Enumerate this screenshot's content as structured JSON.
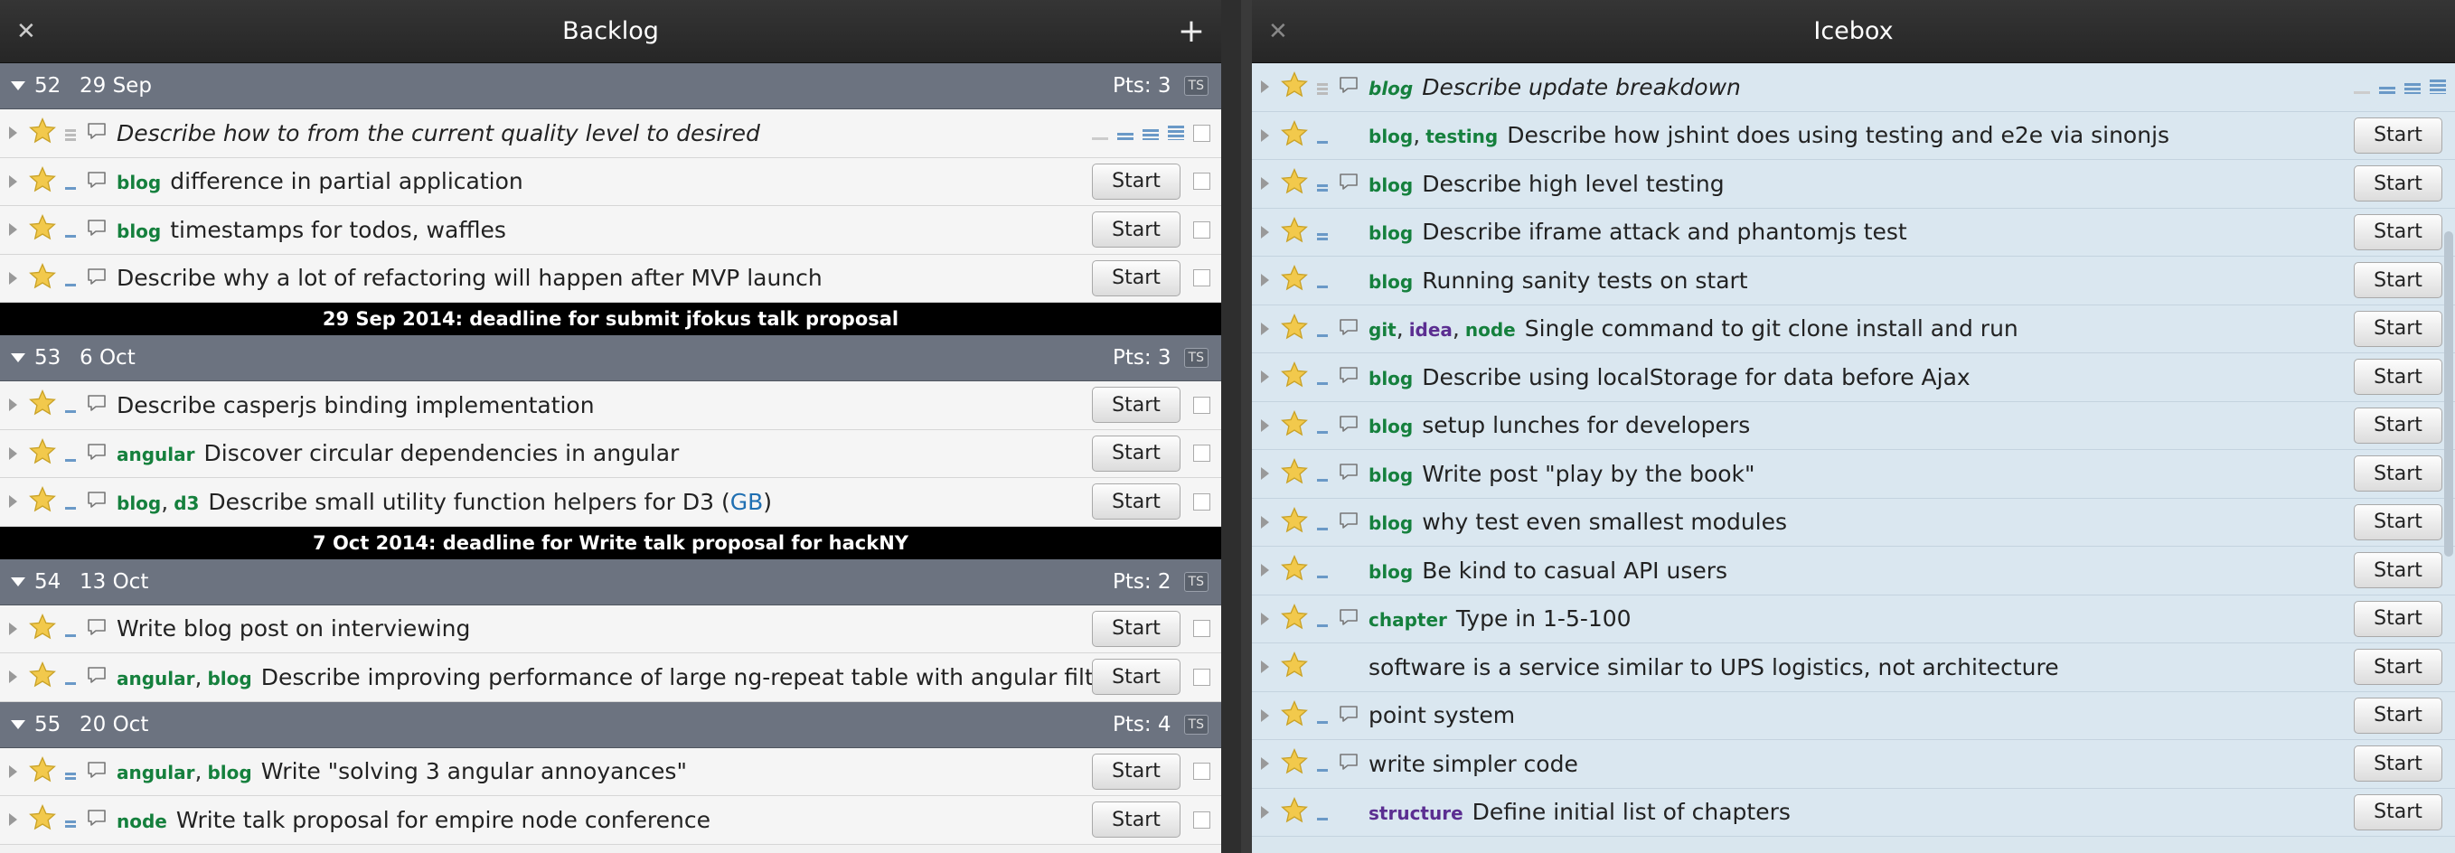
{
  "backlog": {
    "title": "Backlog",
    "close": "✕",
    "add": "+",
    "iterations": [
      {
        "num": "52",
        "date": "29 Sep",
        "pts": "Pts: 3",
        "ts": "TS",
        "stories": [
          {
            "labels": [],
            "title": "Describe how to from the current quality level to desired",
            "italic": true,
            "estimate": "0",
            "comments": true,
            "start": "",
            "edit": true
          },
          {
            "labels": [
              "blog"
            ],
            "title": "difference in partial application",
            "estimate": "1",
            "comments": true,
            "start": "Start"
          },
          {
            "labels": [
              "blog"
            ],
            "title": "timestamps for todos, waffles",
            "estimate": "1",
            "comments": true,
            "start": "Start"
          },
          {
            "labels": [],
            "title": "Describe why a lot of refactoring will happen after MVP launch",
            "estimate": "1",
            "comments": true,
            "start": "Start"
          }
        ],
        "deadline": "29 Sep 2014: deadline for submit jfokus talk proposal"
      },
      {
        "num": "53",
        "date": "6 Oct",
        "pts": "Pts: 3",
        "ts": "TS",
        "stories": [
          {
            "labels": [],
            "title": "Describe casperjs binding implementation",
            "estimate": "1",
            "comments": true,
            "start": "Start"
          },
          {
            "labels": [
              "angular"
            ],
            "title": "Discover circular dependencies in angular",
            "estimate": "1",
            "comments": true,
            "start": "Start"
          },
          {
            "labels": [
              "blog",
              "d3"
            ],
            "title": "Describe small utility function helpers for D3 (",
            "link": "GB",
            "after": ")",
            "estimate": "1",
            "comments": true,
            "start": "Start"
          }
        ],
        "deadline": "7 Oct 2014: deadline for Write talk proposal for hackNY"
      },
      {
        "num": "54",
        "date": "13 Oct",
        "pts": "Pts: 2",
        "ts": "TS",
        "stories": [
          {
            "labels": [],
            "title": "Write blog post on interviewing",
            "estimate": "1",
            "comments": true,
            "start": "Start"
          },
          {
            "labels": [
              "angular",
              "blog"
            ],
            "title": "Describe improving performance of large ng-repeat table with angular filters",
            "estimate": "1",
            "comments": true,
            "start": "Start"
          }
        ]
      },
      {
        "num": "55",
        "date": "20 Oct",
        "pts": "Pts: 4",
        "ts": "TS",
        "stories": [
          {
            "labels": [
              "angular",
              "blog"
            ],
            "title": "Write \"solving 3 angular annoyances\"",
            "estimate": "2",
            "comments": true,
            "start": "Start"
          },
          {
            "labels": [
              "node"
            ],
            "title": "Write talk proposal for empire node conference",
            "estimate": "2",
            "comments": true,
            "start": "Start"
          }
        ]
      }
    ]
  },
  "icebox": {
    "title": "Icebox",
    "close": "✕",
    "stories": [
      {
        "labels": [
          "blog"
        ],
        "title": "Describe update breakdown",
        "italic": true,
        "estimate": "0",
        "comments": true,
        "start": "",
        "edit": true
      },
      {
        "labels": [
          "blog",
          "testing"
        ],
        "title": "Describe how jshint does using testing and e2e via sinonjs",
        "estimate": "1",
        "comments": false,
        "start": "Start"
      },
      {
        "labels": [
          "blog"
        ],
        "title": "Describe high level testing",
        "estimate": "2",
        "comments": true,
        "start": "Start"
      },
      {
        "labels": [
          "blog"
        ],
        "title": "Describe iframe attack and phantomjs test",
        "estimate": "2",
        "comments": false,
        "start": "Start"
      },
      {
        "labels": [
          "blog"
        ],
        "title": "Running sanity tests on start",
        "estimate": "1",
        "comments": false,
        "start": "Start"
      },
      {
        "labels": [
          "git",
          "idea",
          "node"
        ],
        "title": "Single command to git clone install and run",
        "estimate": "1",
        "comments": true,
        "start": "Start"
      },
      {
        "labels": [
          "blog"
        ],
        "title": "Describe using localStorage for data before Ajax",
        "estimate": "1",
        "comments": true,
        "start": "Start"
      },
      {
        "labels": [
          "blog"
        ],
        "title": "setup lunches for developers",
        "estimate": "1",
        "comments": true,
        "start": "Start"
      },
      {
        "labels": [
          "blog"
        ],
        "title": "Write post \"play by the book\"",
        "estimate": "1",
        "comments": true,
        "start": "Start"
      },
      {
        "labels": [
          "blog"
        ],
        "title": "why test even smallest modules",
        "estimate": "1",
        "comments": true,
        "start": "Start"
      },
      {
        "labels": [
          "blog"
        ],
        "title": "Be kind to casual API users",
        "estimate": "1",
        "comments": false,
        "start": "Start"
      },
      {
        "labels": [
          "chapter"
        ],
        "title": "Type in 1-5-100",
        "estimate": "1",
        "comments": true,
        "start": "Start"
      },
      {
        "labels": [],
        "title": "software is a service similar to UPS logistics, not architecture",
        "estimate": "",
        "comments": false,
        "start": "Start"
      },
      {
        "labels": [],
        "title": "point system",
        "estimate": "1",
        "comments": true,
        "start": "Start"
      },
      {
        "labels": [],
        "title": "write simpler code",
        "estimate": "1",
        "comments": true,
        "start": "Start"
      },
      {
        "labels": [
          "structure"
        ],
        "title": "Define initial list of chapters",
        "estimate": "1",
        "comments": false,
        "start": "Start"
      }
    ]
  },
  "colors": {
    "label": "#15803d",
    "labelPurple": "#5b2e91",
    "star": "#f2c94c",
    "iteration": "#6c7380",
    "icebox": "#dae7f0"
  }
}
